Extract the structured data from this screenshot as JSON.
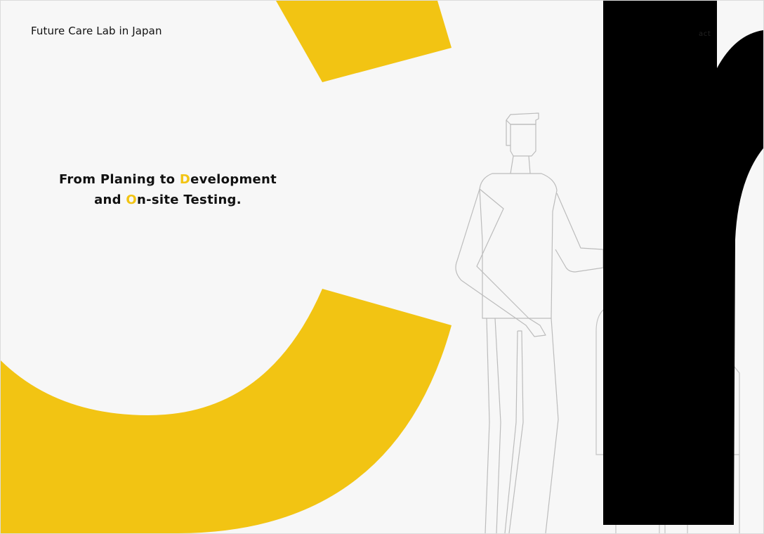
{
  "header": {
    "logo_text": "Future Care Lab in Japan",
    "nav_contact_label": "act"
  },
  "hero": {
    "line1_pre": "From Planing to ",
    "line1_highlight": "D",
    "line1_post": "evelopment",
    "line2_pre": "and ",
    "line2_highlight": "O",
    "line2_post": "n-site Testing."
  },
  "colors": {
    "background": "#f7f7f7",
    "accent_yellow": "#f2c413",
    "text": "#111111",
    "outline_gray": "#bcbcbc",
    "black_shape": "#000000"
  }
}
